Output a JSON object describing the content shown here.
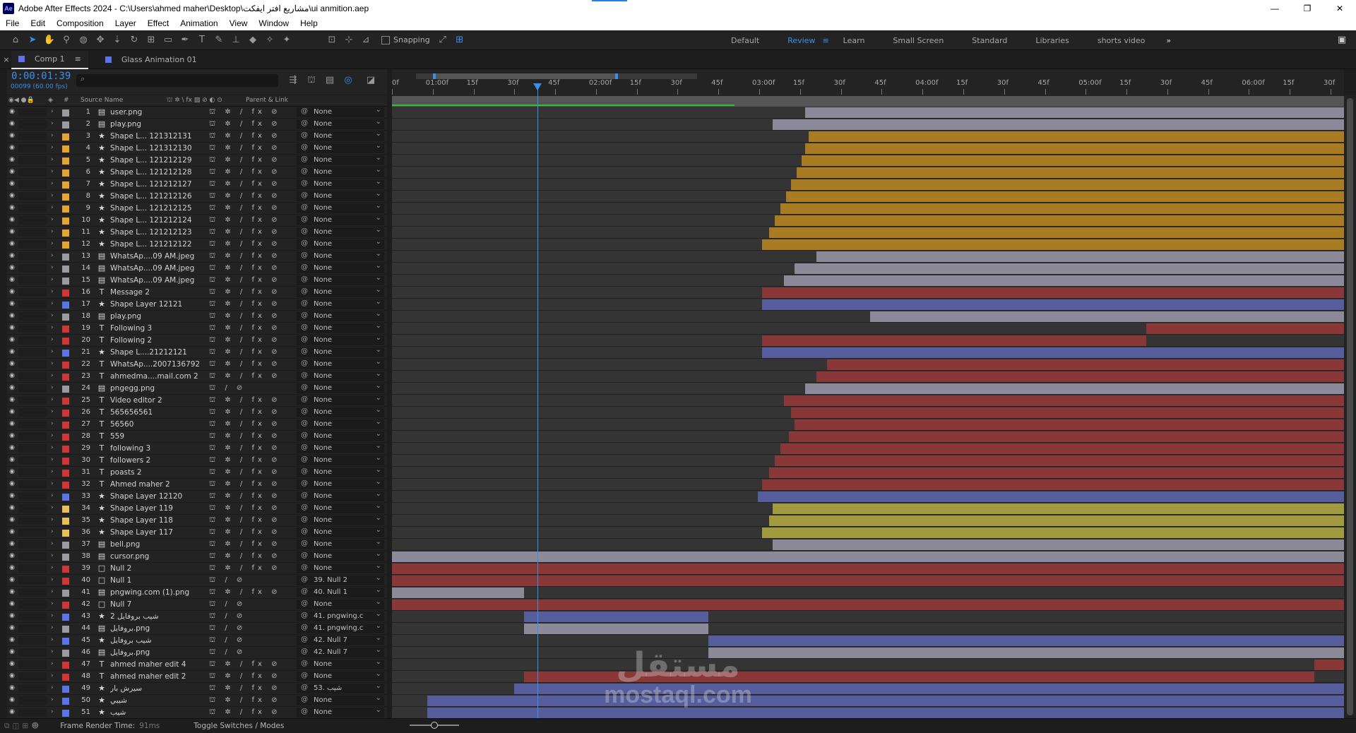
{
  "app": {
    "title": "Adobe After Effects 2024 - C:\\Users\\ahmed maher\\Desktop\\مشاريع افتر ايفكت\\ui anmition.aep",
    "logo": "Ae"
  },
  "window_controls": [
    "—",
    "❐",
    "✕"
  ],
  "menu": [
    "File",
    "Edit",
    "Composition",
    "Layer",
    "Effect",
    "Animation",
    "View",
    "Window",
    "Help"
  ],
  "toolbar": {
    "tools": [
      "home-icon",
      "selection-tool-icon",
      "hand-tool-icon",
      "zoom-tool-icon",
      "orbit-camera-icon",
      "pan-camera-icon",
      "dolly-camera-icon",
      "rotation-tool-icon",
      "pan-behind-icon",
      "rectangle-tool-icon",
      "pen-tool-icon",
      "type-tool-icon",
      "brush-tool-icon",
      "clone-stamp-icon",
      "eraser-icon",
      "roto-brush-icon",
      "puppet-pin-icon"
    ],
    "snapping_label": "Snapping",
    "workspaces": [
      "Default",
      "Review",
      "Learn",
      "Small Screen",
      "Standard",
      "Libraries",
      "shorts video"
    ],
    "active_workspace": "Review"
  },
  "tabs": [
    {
      "label": "Comp 1",
      "active": true
    },
    {
      "label": "Glass Animation 01",
      "active": false
    }
  ],
  "timeline": {
    "timecode": "0:00:01:39",
    "frames_label": "00099 (60.00 fps)",
    "search_placeholder": "⌕",
    "columns": {
      "number": "#",
      "source_name": "Source Name",
      "parent": "Parent & Link"
    },
    "ruler_ticks": [
      "0f",
      "01:00f",
      "15f",
      "30f",
      "45f",
      "02:00f",
      "15f",
      "30f",
      "45f",
      "03:00f",
      "15f",
      "30f",
      "45f",
      "04:00f",
      "15f",
      "30f",
      "45f",
      "05:00f",
      "15f",
      "30f",
      "45f",
      "06:00f",
      "15f",
      "30f"
    ]
  },
  "layers": [
    {
      "num": "1",
      "type": "img",
      "name": "user.png",
      "label": "#9a9aa0",
      "parent": "None",
      "fx": true,
      "bar": [
        0.434,
        1.0
      ],
      "color": "#8c8a99"
    },
    {
      "num": "2",
      "type": "img",
      "name": "play.png",
      "label": "#9a9aa0",
      "parent": "None",
      "fx": true,
      "bar": [
        0.4,
        1.0
      ],
      "color": "#8c8a99"
    },
    {
      "num": "3",
      "type": "star",
      "name": "Shape L... 121312131",
      "label": "#e5a532",
      "parent": "None",
      "fx": true,
      "bar": [
        0.438,
        1.0
      ],
      "color": "#a97c23"
    },
    {
      "num": "4",
      "type": "star",
      "name": "Shape L... 121312130",
      "label": "#e5a532",
      "parent": "None",
      "fx": true,
      "bar": [
        0.434,
        1.0
      ],
      "color": "#a97c23"
    },
    {
      "num": "5",
      "type": "star",
      "name": "Shape L... 121212129",
      "label": "#e5a532",
      "parent": "None",
      "fx": true,
      "bar": [
        0.43,
        1.0
      ],
      "color": "#a97c23"
    },
    {
      "num": "6",
      "type": "star",
      "name": "Shape L... 121212128",
      "label": "#e5a532",
      "parent": "None",
      "fx": true,
      "bar": [
        0.425,
        1.0
      ],
      "color": "#a97c23"
    },
    {
      "num": "7",
      "type": "star",
      "name": "Shape L... 121212127",
      "label": "#e5a532",
      "parent": "None",
      "fx": true,
      "bar": [
        0.419,
        1.0
      ],
      "color": "#a97c23"
    },
    {
      "num": "8",
      "type": "star",
      "name": "Shape L... 121212126",
      "label": "#e5a532",
      "parent": "None",
      "fx": true,
      "bar": [
        0.414,
        1.0
      ],
      "color": "#a97c23"
    },
    {
      "num": "9",
      "type": "star",
      "name": "Shape L... 121212125",
      "label": "#e5a532",
      "parent": "None",
      "fx": true,
      "bar": [
        0.408,
        1.0
      ],
      "color": "#a97c23"
    },
    {
      "num": "10",
      "type": "star",
      "name": "Shape L... 121212124",
      "label": "#e5a532",
      "parent": "None",
      "fx": true,
      "bar": [
        0.402,
        1.0
      ],
      "color": "#a97c23"
    },
    {
      "num": "11",
      "type": "star",
      "name": "Shape L... 121212123",
      "label": "#e5a532",
      "parent": "None",
      "fx": true,
      "bar": [
        0.396,
        1.0
      ],
      "color": "#a97c23"
    },
    {
      "num": "12",
      "type": "star",
      "name": "Shape L... 121212122",
      "label": "#e5a532",
      "parent": "None",
      "fx": true,
      "bar": [
        0.389,
        1.0
      ],
      "color": "#a97c23"
    },
    {
      "num": "13",
      "type": "img",
      "name": "WhatsAp....09 AM.jpeg",
      "label": "#9a9aa0",
      "parent": "None",
      "fx": true,
      "bar": [
        0.446,
        1.0
      ],
      "color": "#8c8a99"
    },
    {
      "num": "14",
      "type": "img",
      "name": "WhatsAp....09 AM.jpeg",
      "label": "#9a9aa0",
      "parent": "None",
      "fx": true,
      "bar": [
        0.423,
        1.0
      ],
      "color": "#8c8a99"
    },
    {
      "num": "15",
      "type": "img",
      "name": "WhatsAp....09 AM.jpeg",
      "label": "#9a9aa0",
      "parent": "None",
      "fx": true,
      "bar": [
        0.412,
        1.0
      ],
      "color": "#8c8a99"
    },
    {
      "num": "16",
      "type": "T",
      "name": "Message 2",
      "label": "#d03636",
      "parent": "None",
      "fx": true,
      "bar": [
        0.389,
        1.0
      ],
      "color": "#8a3738",
      "box": true
    },
    {
      "num": "17",
      "type": "star",
      "name": "Shape Layer 12121",
      "label": "#5b74e8",
      "parent": "None",
      "fx": true,
      "bar": [
        0.389,
        1.0
      ],
      "color": "#555d9c",
      "box": true
    },
    {
      "num": "18",
      "type": "img",
      "name": "play.png",
      "label": "#9a9aa0",
      "parent": "None",
      "fx": true,
      "bar": [
        0.502,
        1.0
      ],
      "color": "#8c8a99"
    },
    {
      "num": "19",
      "type": "T",
      "name": "Following 3",
      "label": "#d03636",
      "parent": "None",
      "fx": true,
      "bar": [
        0.792,
        1.0
      ],
      "color": "#8a3738",
      "box": true
    },
    {
      "num": "20",
      "type": "T",
      "name": "Following 2",
      "label": "#d03636",
      "parent": "None",
      "fx": true,
      "bar": [
        0.389,
        0.792
      ],
      "color": "#8a3738",
      "box": true
    },
    {
      "num": "21",
      "type": "star",
      "name": "Shape L....21212121",
      "label": "#5b74e8",
      "parent": "None",
      "fx": true,
      "bar": [
        0.389,
        1.0
      ],
      "color": "#555d9c",
      "box": true
    },
    {
      "num": "22",
      "type": "T",
      "name": "WhatsAp....2007136792",
      "label": "#d03636",
      "parent": "None",
      "fx": true,
      "bar": [
        0.457,
        1.0
      ],
      "color": "#8a3738"
    },
    {
      "num": "23",
      "type": "T",
      "name": "ahmedma....mail.com 2",
      "label": "#d03636",
      "parent": "None",
      "fx": true,
      "bar": [
        0.446,
        1.0
      ],
      "color": "#8a3738"
    },
    {
      "num": "24",
      "type": "img",
      "name": "pngegg.png",
      "label": "#9a9aa0",
      "parent": "None",
      "fx": false,
      "bar": [
        0.434,
        1.0
      ],
      "color": "#8c8a99"
    },
    {
      "num": "25",
      "type": "T",
      "name": "Video editor 2",
      "label": "#d03636",
      "parent": "None",
      "fx": true,
      "bar": [
        0.412,
        1.0
      ],
      "color": "#8a3738"
    },
    {
      "num": "26",
      "type": "T",
      "name": "565656561",
      "label": "#d03636",
      "parent": "None",
      "fx": true,
      "bar": [
        0.419,
        1.0
      ],
      "color": "#8a3738"
    },
    {
      "num": "27",
      "type": "T",
      "name": "56560",
      "label": "#d03636",
      "parent": "None",
      "fx": true,
      "bar": [
        0.423,
        1.0
      ],
      "color": "#8a3738"
    },
    {
      "num": "28",
      "type": "T",
      "name": "559",
      "label": "#d03636",
      "parent": "None",
      "fx": true,
      "bar": [
        0.417,
        1.0
      ],
      "color": "#8a3738"
    },
    {
      "num": "29",
      "type": "T",
      "name": "following 3",
      "label": "#d03636",
      "parent": "None",
      "fx": true,
      "bar": [
        0.408,
        1.0
      ],
      "color": "#8a3738"
    },
    {
      "num": "30",
      "type": "T",
      "name": "followers 2",
      "label": "#d03636",
      "parent": "None",
      "fx": true,
      "bar": [
        0.402,
        1.0
      ],
      "color": "#8a3738"
    },
    {
      "num": "31",
      "type": "T",
      "name": "poasts 2",
      "label": "#d03636",
      "parent": "None",
      "fx": true,
      "bar": [
        0.396,
        1.0
      ],
      "color": "#8a3738"
    },
    {
      "num": "32",
      "type": "T",
      "name": "Ahmed maher 2",
      "label": "#d03636",
      "parent": "None",
      "fx": true,
      "bar": [
        0.389,
        1.0
      ],
      "color": "#8a3738"
    },
    {
      "num": "33",
      "type": "star",
      "name": "Shape Layer 12120",
      "label": "#5b74e8",
      "parent": "None",
      "fx": true,
      "bar": [
        0.384,
        1.0
      ],
      "color": "#555d9c"
    },
    {
      "num": "34",
      "type": "star",
      "name": "Shape Layer 119",
      "label": "#e8c05a",
      "parent": "None",
      "fx": true,
      "bar": [
        0.4,
        1.0
      ],
      "color": "#a29a3e"
    },
    {
      "num": "35",
      "type": "star",
      "name": "Shape Layer 118",
      "label": "#e8c05a",
      "parent": "None",
      "fx": true,
      "bar": [
        0.396,
        1.0
      ],
      "color": "#a29a3e"
    },
    {
      "num": "36",
      "type": "star",
      "name": "Shape Layer 117",
      "label": "#e8c05a",
      "parent": "None",
      "fx": true,
      "bar": [
        0.389,
        1.0
      ],
      "color": "#a29a3e"
    },
    {
      "num": "37",
      "type": "img",
      "name": "bell.png",
      "label": "#9a9aa0",
      "parent": "None",
      "fx": true,
      "bar": [
        0.4,
        1.0
      ],
      "color": "#8c8a99"
    },
    {
      "num": "38",
      "type": "img",
      "name": "cursor.png",
      "label": "#9a9aa0",
      "parent": "None",
      "fx": true,
      "bar": [
        0.0,
        1.0
      ],
      "color": "#8c8a99"
    },
    {
      "num": "39",
      "type": "null",
      "name": "Null 2",
      "label": "#d03636",
      "parent": "None",
      "fx": true,
      "bar": [
        0.0,
        1.0
      ],
      "color": "#8a3738"
    },
    {
      "num": "40",
      "type": "null",
      "name": "Null 1",
      "label": "#d03636",
      "parent": "39. Null 2",
      "fx": false,
      "bar": [
        0.0,
        1.0
      ],
      "color": "#8a3738"
    },
    {
      "num": "41",
      "type": "img",
      "name": "pngwing.com (1).png",
      "label": "#9a9aa0",
      "parent": "40. Null 1",
      "fx": true,
      "bar": [
        0.0,
        0.139
      ],
      "color": "#8c8a99"
    },
    {
      "num": "42",
      "type": "null",
      "name": "Null 7",
      "label": "#d03636",
      "parent": "None",
      "fx": false,
      "bar": [
        0.0,
        1.0
      ],
      "color": "#8a3738"
    },
    {
      "num": "43",
      "type": "star",
      "name": "شيب بروفايل 2",
      "label": "#5b74e8",
      "parent": "41. pngwing.c",
      "fx": false,
      "bar": [
        0.139,
        0.332
      ],
      "color": "#555d9c",
      "box": true
    },
    {
      "num": "44",
      "type": "img",
      "name": "بروفايل.png",
      "label": "#9a9aa0",
      "parent": "41. pngwing.c",
      "fx": false,
      "bar": [
        0.139,
        0.332
      ],
      "color": "#8c8a99",
      "box": true
    },
    {
      "num": "45",
      "type": "star",
      "name": "شيب بروفايل",
      "label": "#5b74e8",
      "parent": "42. Null 7",
      "fx": false,
      "bar": [
        0.332,
        1.0
      ],
      "color": "#555d9c",
      "box": true
    },
    {
      "num": "46",
      "type": "img",
      "name": "بروفايل.png",
      "label": "#9a9aa0",
      "parent": "42. Null 7",
      "fx": false,
      "bar": [
        0.332,
        1.0
      ],
      "color": "#8c8a99",
      "box": true
    },
    {
      "num": "47",
      "type": "T",
      "name": "ahmed maher edit 4",
      "label": "#d03636",
      "parent": "None",
      "fx": true,
      "bar": [
        0.969,
        1.0
      ],
      "color": "#8a3738"
    },
    {
      "num": "48",
      "type": "T",
      "name": "ahmed maher edit 2",
      "label": "#d03636",
      "parent": "None",
      "fx": true,
      "bar": [
        0.139,
        0.969
      ],
      "color": "#8a3738"
    },
    {
      "num": "49",
      "type": "star",
      "name": "سيرش بار",
      "label": "#5b74e8",
      "parent": "53. شيب",
      "fx": true,
      "bar": [
        0.128,
        1.0
      ],
      "color": "#555d9c"
    },
    {
      "num": "50",
      "type": "star",
      "name": "شيبي",
      "label": "#5b74e8",
      "parent": "None",
      "fx": true,
      "bar": [
        0.037,
        1.0
      ],
      "color": "#555d9c"
    },
    {
      "num": "51",
      "type": "star",
      "name": "شيب",
      "label": "#5b74e8",
      "parent": "None",
      "fx": true,
      "bar": [
        0.037,
        1.0
      ],
      "color": "#555d9c"
    }
  ],
  "statusbar": {
    "render_label": "Frame Render Time:",
    "render_value": "91ms",
    "toggle_label": "Toggle Switches / Modes"
  },
  "watermark": {
    "arabic": "مستقل",
    "latin": "mostaql.com"
  }
}
